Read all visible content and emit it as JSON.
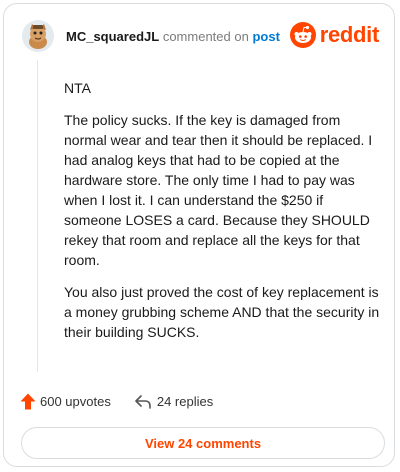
{
  "comment": {
    "username": "MC_squaredJL",
    "commented_text": "commented on",
    "post_link": "post",
    "paragraphs": [
      "NTA",
      "The policy sucks. If the key is damaged from normal wear and tear then it should be replaced. I had analog keys that had to be copied at the hardware store. The only time I had to pay was when I lost it. I can understand the $250 if someone LOSES a card. Because they SHOULD rekey that room and replace all the keys for that room.",
      "You also just proved the cost of key replacement is a money grubbing scheme AND that the security in their building SUCKS."
    ]
  },
  "logo": {
    "word": "reddit",
    "icon": "reddit-alien-icon"
  },
  "actions": {
    "upvotes": "600 upvotes",
    "replies": "24 replies",
    "upvote_icon": "upvote-arrow-icon",
    "reply_icon": "reply-arrow-icon"
  },
  "view_button": {
    "label": "View 24 comments"
  },
  "colors": {
    "accent": "#ff4500",
    "link": "#0079d3",
    "border": "#d9dde0",
    "muted": "#7c7c7c"
  }
}
